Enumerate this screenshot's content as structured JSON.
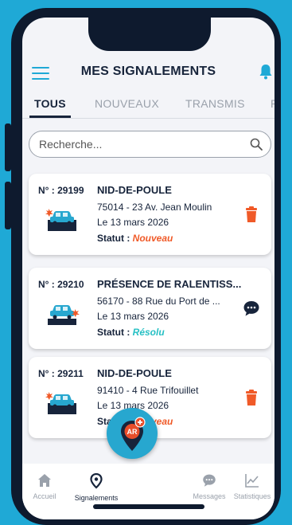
{
  "header": {
    "title": "MES SIGNALEMENTS"
  },
  "tabs": [
    {
      "label": "TOUS"
    },
    {
      "label": "NOUVEAUX"
    },
    {
      "label": "TRANSMIS"
    },
    {
      "label": "R"
    }
  ],
  "search": {
    "placeholder": "Recherche..."
  },
  "cards": [
    {
      "number": "N° : 29199",
      "type": "NID-DE-POULE",
      "address": "75014 - 23 Av. Jean Moulin",
      "date": "Le 13 mars 2026",
      "status_label": "Statut :",
      "status": "Nouveau",
      "action": "trash-icon"
    },
    {
      "number": "N° : 29210",
      "type": "PRÉSENCE DE RALENTISS...",
      "address": "56170 - 88 Rue du Port de ...",
      "date": "Le 13 mars 2026",
      "status_label": "Statut :",
      "status": "Résolu",
      "action": "chat-icon"
    },
    {
      "number": "N° : 29211",
      "type": "NID-DE-POULE",
      "address": "91410 - 4 Rue Trifouillet",
      "date": "Le 13 mars 2026",
      "status_label": "Statut :",
      "status": "Nouveau",
      "action": "trash-icon"
    }
  ],
  "nav": {
    "home": "Accueil",
    "reports": "Signalements",
    "messages": "Messages",
    "stats": "Statistiques"
  },
  "fab": {
    "label": "AR"
  },
  "colors": {
    "accent": "#1fa9d6",
    "dark": "#17243b",
    "danger": "#f05a28",
    "resolved": "#27c0c4"
  }
}
